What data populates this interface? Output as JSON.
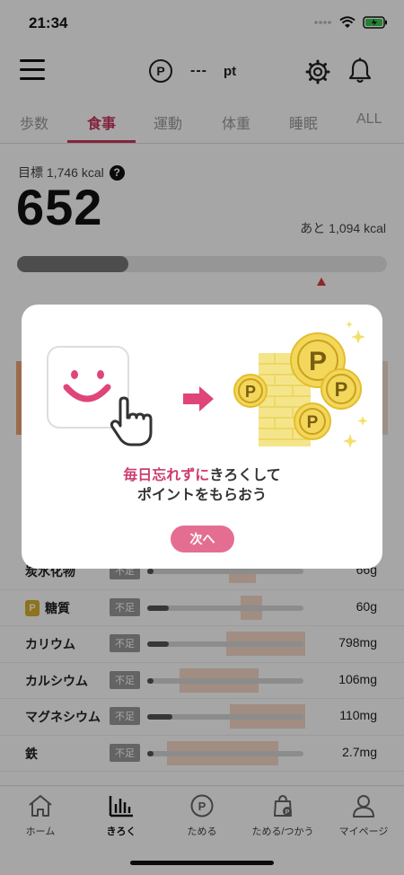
{
  "status_bar": {
    "time": "21:34"
  },
  "header": {
    "points_value": "---",
    "points_unit": "pt"
  },
  "tabs": [
    {
      "label": "歩数"
    },
    {
      "label": "食事"
    },
    {
      "label": "運動"
    },
    {
      "label": "体重"
    },
    {
      "label": "睡眠"
    },
    {
      "label": "ALL"
    }
  ],
  "summary": {
    "goal_label": "目標 1,746 kcal",
    "current_value": "652",
    "remaining_label": "あと 1,094 kcal",
    "progress": 0.3
  },
  "nutrients": [
    {
      "name": "炭水化物",
      "tag": "不足",
      "value": "66g",
      "has_p": false,
      "level": 0.0
    },
    {
      "name": "糖質",
      "tag": "不足",
      "value": "60g",
      "has_p": true,
      "level": 0.14
    },
    {
      "name": "カリウム",
      "tag": "不足",
      "value": "798mg",
      "has_p": false,
      "level": 0.14
    },
    {
      "name": "カルシウム",
      "tag": "不足",
      "value": "106mg",
      "has_p": false,
      "level": 0.03
    },
    {
      "name": "マグネシウム",
      "tag": "不足",
      "value": "110mg",
      "has_p": false,
      "level": 0.16
    },
    {
      "name": "鉄",
      "tag": "不足",
      "value": "2.7mg",
      "has_p": false,
      "level": 0.04
    }
  ],
  "tab_bar": [
    {
      "label": "ホーム",
      "icon": "home-icon"
    },
    {
      "label": "きろく",
      "icon": "chart-icon"
    },
    {
      "label": "ためる",
      "icon": "points-icon"
    },
    {
      "label": "ためる/つかう",
      "icon": "shopping-bag-icon"
    },
    {
      "label": "マイページ",
      "icon": "person-icon"
    }
  ],
  "modal": {
    "message_accent": "毎日忘れずに",
    "message_rest": "きろくして",
    "message_line2": "ポイントをもらおう",
    "next_label": "次へ"
  },
  "colors": {
    "accent": "#c9385f",
    "button": "#e46e91",
    "coin": "#f3d75a"
  }
}
